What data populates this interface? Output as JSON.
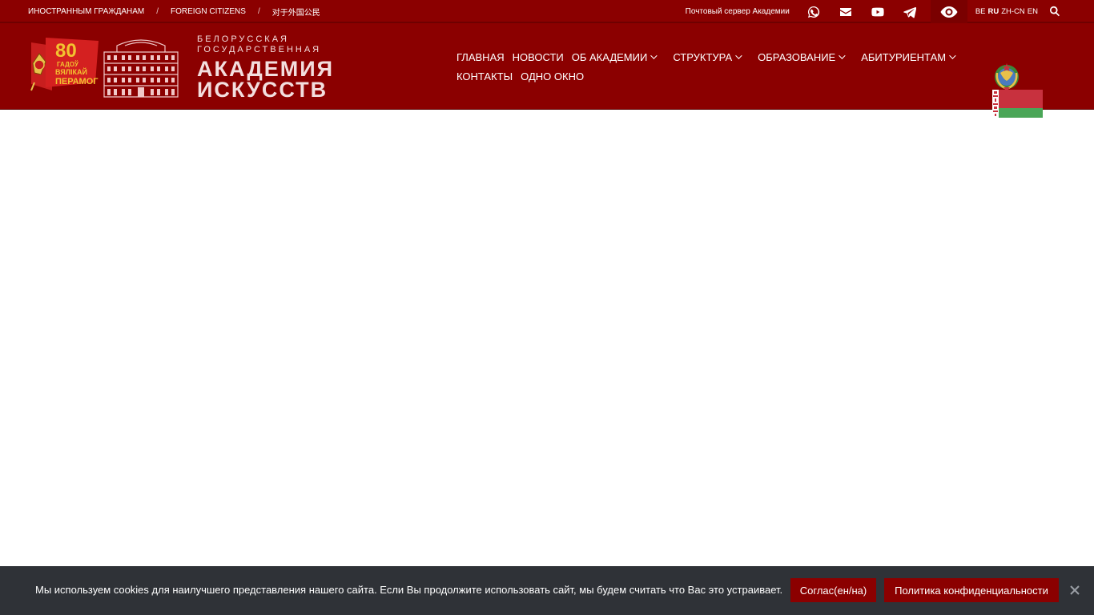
{
  "topbar": {
    "links": [
      "ИНОСТРАННЫМ ГРАЖДАНАМ",
      "FOREIGN CITIZENS",
      "对于外国公民"
    ],
    "separator": "/",
    "mail_server": "Почтовый сервер Академии",
    "icons": [
      "whatsapp-icon",
      "envelope-icon",
      "youtube-icon",
      "telegram-icon",
      "eye-icon",
      "search-icon"
    ],
    "langs": [
      "BE",
      "RU",
      "ZH-CN",
      "EN"
    ],
    "active_lang": "RU"
  },
  "header": {
    "logo80": {
      "number": "80",
      "line1": "ГАДОЎ",
      "line2": "ВЯЛІКАЙ",
      "line3": "ПЕРАМОГІ"
    },
    "brand": {
      "line1": "БЕЛОРУССКАЯ",
      "line2": "ГОСУДАРСТВЕННАЯ",
      "line3": "АКАДЕМИЯ",
      "line4": "ИСКУССТВ"
    }
  },
  "nav": {
    "row1": [
      {
        "label": "ГЛАВНАЯ",
        "dropdown": false
      },
      {
        "label": "НОВОСТИ",
        "dropdown": false
      },
      {
        "label": "ОБ АКАДЕМИИ",
        "dropdown": true
      },
      {
        "label": "СТРУКТУРА",
        "dropdown": true
      },
      {
        "label": "ОБРАЗОВАНИЕ",
        "dropdown": true
      },
      {
        "label": "АБИТУРИЕНТАМ",
        "dropdown": true
      }
    ],
    "row2": [
      {
        "label": "КОНТАКТЫ",
        "dropdown": false
      },
      {
        "label": "ОДНО ОКНО",
        "dropdown": false
      }
    ]
  },
  "cookie": {
    "message": "Мы используем cookies для наилучшего представления нашего сайта. Если Вы продолжите использовать сайт, мы будем считать что Вас это устраивает.",
    "accept_label": "Соглас(ен/на)",
    "policy_label": "Политика конфиденциальности"
  },
  "colors": {
    "brand": "#8b0000",
    "cookie_bg": "#2f3237",
    "flag_red": "#c8313e",
    "flag_green": "#4aa657"
  }
}
